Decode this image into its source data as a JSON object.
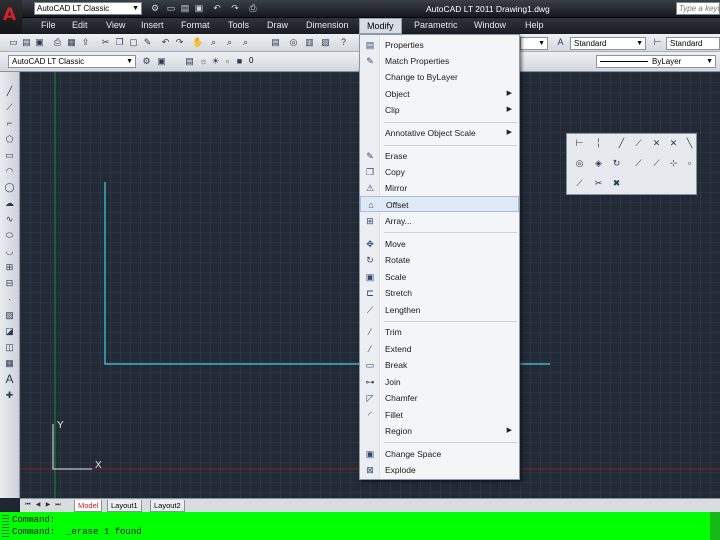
{
  "titlebar": {
    "workspace": "AutoCAD LT Classic",
    "title": "AutoCAD LT 2011    Drawing1.dwg",
    "search_placeholder": "Type a keyw"
  },
  "menubar": [
    "File",
    "Edit",
    "View",
    "Insert",
    "Format",
    "Tools",
    "Draw",
    "Dimension",
    "Modify",
    "Parametric",
    "Window",
    "Help"
  ],
  "toolbar": {
    "textstyle": "Standard",
    "dimstyle": "Standard",
    "workspace2": "AutoCAD LT Classic",
    "lineweight": "ByLayer",
    "layer": "0"
  },
  "modify_menu": {
    "items": [
      {
        "label": "Properties",
        "icon": "properties-icon"
      },
      {
        "label": "Match Properties",
        "icon": "match-properties-icon"
      },
      {
        "label": "Change to ByLayer",
        "icon": ""
      },
      {
        "label": "Object",
        "icon": "",
        "submenu": true
      },
      {
        "label": "Clip",
        "icon": "",
        "submenu": true
      },
      {
        "label": "Annotative Object Scale",
        "icon": "",
        "submenu": true
      },
      {
        "label": "Erase",
        "icon": "erase-icon"
      },
      {
        "label": "Copy",
        "icon": "copy-icon"
      },
      {
        "label": "Mirror",
        "icon": "mirror-icon"
      },
      {
        "label": "Offset",
        "icon": "offset-icon"
      },
      {
        "label": "Array...",
        "icon": "array-icon"
      },
      {
        "label": "Move",
        "icon": "move-icon"
      },
      {
        "label": "Rotate",
        "icon": "rotate-icon"
      },
      {
        "label": "Scale",
        "icon": "scale-icon"
      },
      {
        "label": "Stretch",
        "icon": "stretch-icon"
      },
      {
        "label": "Lengthen",
        "icon": "lengthen-icon"
      },
      {
        "label": "Trim",
        "icon": "trim-icon"
      },
      {
        "label": "Extend",
        "icon": "extend-icon"
      },
      {
        "label": "Break",
        "icon": "break-icon"
      },
      {
        "label": "Join",
        "icon": "join-icon"
      },
      {
        "label": "Chamfer",
        "icon": "chamfer-icon"
      },
      {
        "label": "Fillet",
        "icon": "fillet-icon"
      },
      {
        "label": "Region",
        "icon": "",
        "submenu": true
      },
      {
        "label": "Change Space",
        "icon": "change-space-icon"
      },
      {
        "label": "Explode",
        "icon": "explode-icon"
      }
    ]
  },
  "ucs": {
    "x_label": "X",
    "y_label": "Y"
  },
  "tabs": [
    "Model",
    "Layout1",
    "Layout2"
  ],
  "command_lines": [
    "Command:",
    "Command:  _erase 1 found"
  ],
  "colors": {
    "canvas": "#212a35",
    "cmd_bg": "#00ff00",
    "cyan_line": "#3fd2e6",
    "green_axis": "#1e8a33",
    "red_axis": "#8a1e1e",
    "active_tab": "#d21c1c"
  }
}
